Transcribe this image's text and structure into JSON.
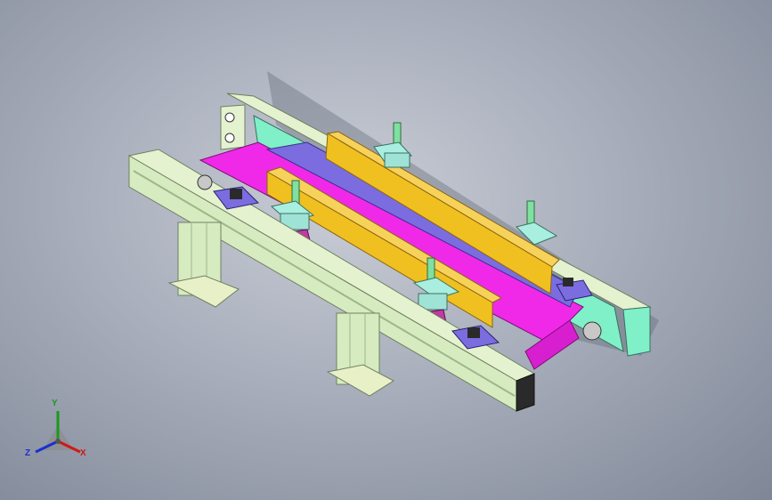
{
  "viewport": {
    "background_top": "#c9cdd6",
    "background_bottom": "#7f8797"
  },
  "model": {
    "description_icon": "belt-conveyor-assembly",
    "colors": {
      "frame": "#d6ecc0",
      "frame_dark": "#9fb68a",
      "belt": "#f029e8",
      "belt_dark": "#b01aa8",
      "plate": "#7b6ce0",
      "guide": "#f0c020",
      "guide_dark": "#b58c10",
      "side_panel": "#7ff0c8",
      "clamp": "#a8efe0",
      "post": "#7fe0a0",
      "base_mount": "#c03aa0",
      "block_dark": "#2a2a2a"
    }
  },
  "triad": {
    "x_label": "X",
    "y_label": "Y",
    "z_label": "Z",
    "x_color": "#d01818",
    "y_color": "#1a9a1a",
    "z_color": "#1a2fd0"
  }
}
